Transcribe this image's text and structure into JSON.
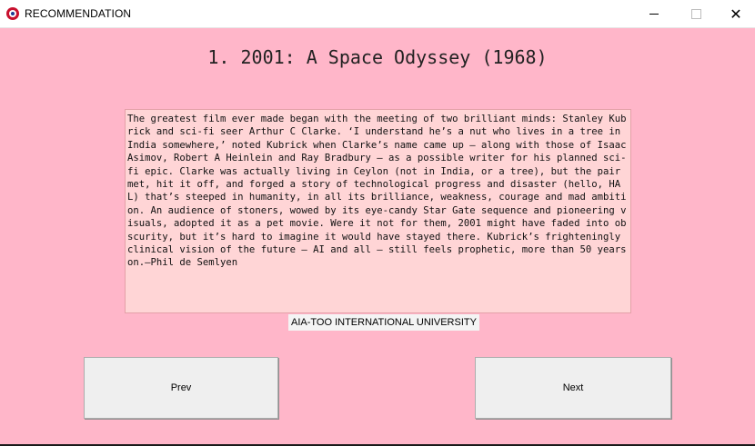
{
  "window": {
    "title": "RECOMMENDATION",
    "icon": "university-logo-icon",
    "controls": {
      "minimize": "minimize-icon",
      "maximize": "maximize-icon",
      "close": "✕"
    }
  },
  "movie": {
    "heading": "1. 2001: A Space Odyssey (1968)",
    "description": "The greatest film ever made began with the meeting of two brilliant minds: Stanley Kubrick and sci-fi seer Arthur C Clarke. ‘I understand he’s a nut who lives in a tree in India somewhere,’ noted Kubrick when Clarke’s name came up – along with those of Isaac Asimov, Robert A Heinlein and Ray Bradbury – as a possible writer for his planned sci-fi epic. Clarke was actually living in Ceylon (not in India, or a tree), but the pair met, hit it off, and forged a story of technological progress and disaster (hello, HAL) that’s steeped in humanity, in all its brilliance, weakness, courage and mad ambition. An audience of stoners, wowed by its eye-candy Star Gate sequence and pioneering visuals, adopted it as a pet movie. Were it not for them, 2001 might have faded into obscurity, but it’s hard to imagine it would have stayed there. Kubrick’s frighteningly clinical vision of the future – AI and all – still feels prophetic, more than 50 years on.—Phil de Semlyen"
  },
  "footer": {
    "university": "AIA-TOO INTERNATIONAL UNIVERSITY"
  },
  "buttons": {
    "prev": "Prev",
    "next": "Next"
  },
  "colors": {
    "background": "#ffb6c9",
    "text_area": "#ffd5d6",
    "button": "#efefef"
  }
}
